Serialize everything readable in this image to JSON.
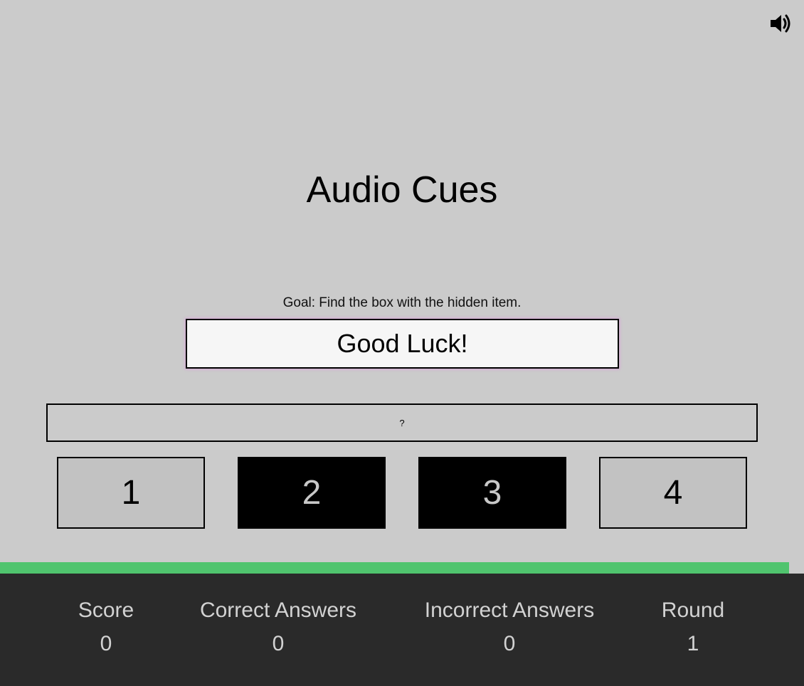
{
  "header": {
    "sound_icon": "speaker-volume-icon"
  },
  "game": {
    "title": "Audio Cues",
    "goal": "Goal: Find the box with the hidden item.",
    "message": "Good Luck!",
    "hint": "?",
    "boxes": [
      {
        "label": "1",
        "state": "light"
      },
      {
        "label": "2",
        "state": "dark"
      },
      {
        "label": "3",
        "state": "dark"
      },
      {
        "label": "4",
        "state": "light"
      }
    ]
  },
  "progress": {
    "fraction": 0.981,
    "color": "#50c46e"
  },
  "stats": {
    "score": {
      "label": "Score",
      "value": "0"
    },
    "correct": {
      "label": "Correct Answers",
      "value": "0"
    },
    "incorrect": {
      "label": "Incorrect Answers",
      "value": "0"
    },
    "round": {
      "label": "Round",
      "value": "1"
    }
  },
  "colors": {
    "background": "#cbcbcb",
    "stats_background": "#2a2a2a",
    "box_light": "#c2c2c2",
    "box_dark": "#000000"
  }
}
